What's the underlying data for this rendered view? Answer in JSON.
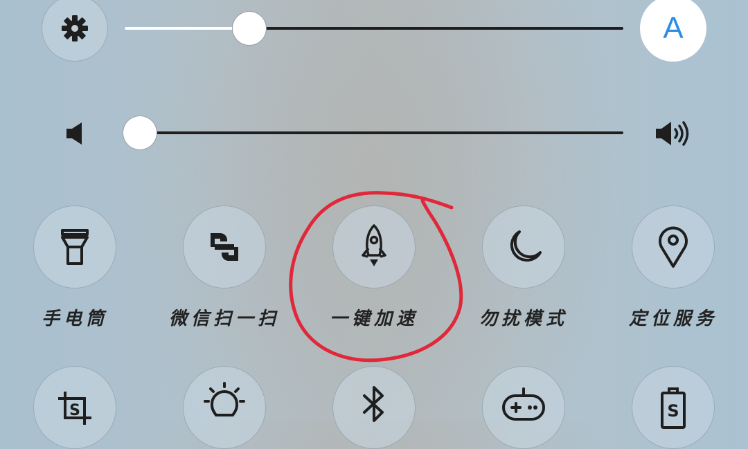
{
  "brightness": {
    "icon": "gear-icon",
    "level_percent": 25,
    "auto_label": "A"
  },
  "volume": {
    "mute_icon": "volume-low-icon",
    "max_icon": "volume-high-icon",
    "level_percent": 3
  },
  "tiles_row1": [
    {
      "icon": "flashlight-icon",
      "label": "手电筒"
    },
    {
      "icon": "wechat-scan-icon",
      "label": "微信扫一扫"
    },
    {
      "icon": "rocket-icon",
      "label": "一键加速"
    },
    {
      "icon": "moon-icon",
      "label": "勿扰模式"
    },
    {
      "icon": "location-pin-icon",
      "label": "定位服务"
    }
  ],
  "tiles_row2": [
    {
      "icon": "screenshot-icon"
    },
    {
      "icon": "lightbulb-icon"
    },
    {
      "icon": "bluetooth-icon"
    },
    {
      "icon": "gamepad-icon"
    },
    {
      "icon": "battery-saver-icon"
    }
  ],
  "annotation": {
    "color": "#e0283a",
    "target": "一键加速"
  }
}
